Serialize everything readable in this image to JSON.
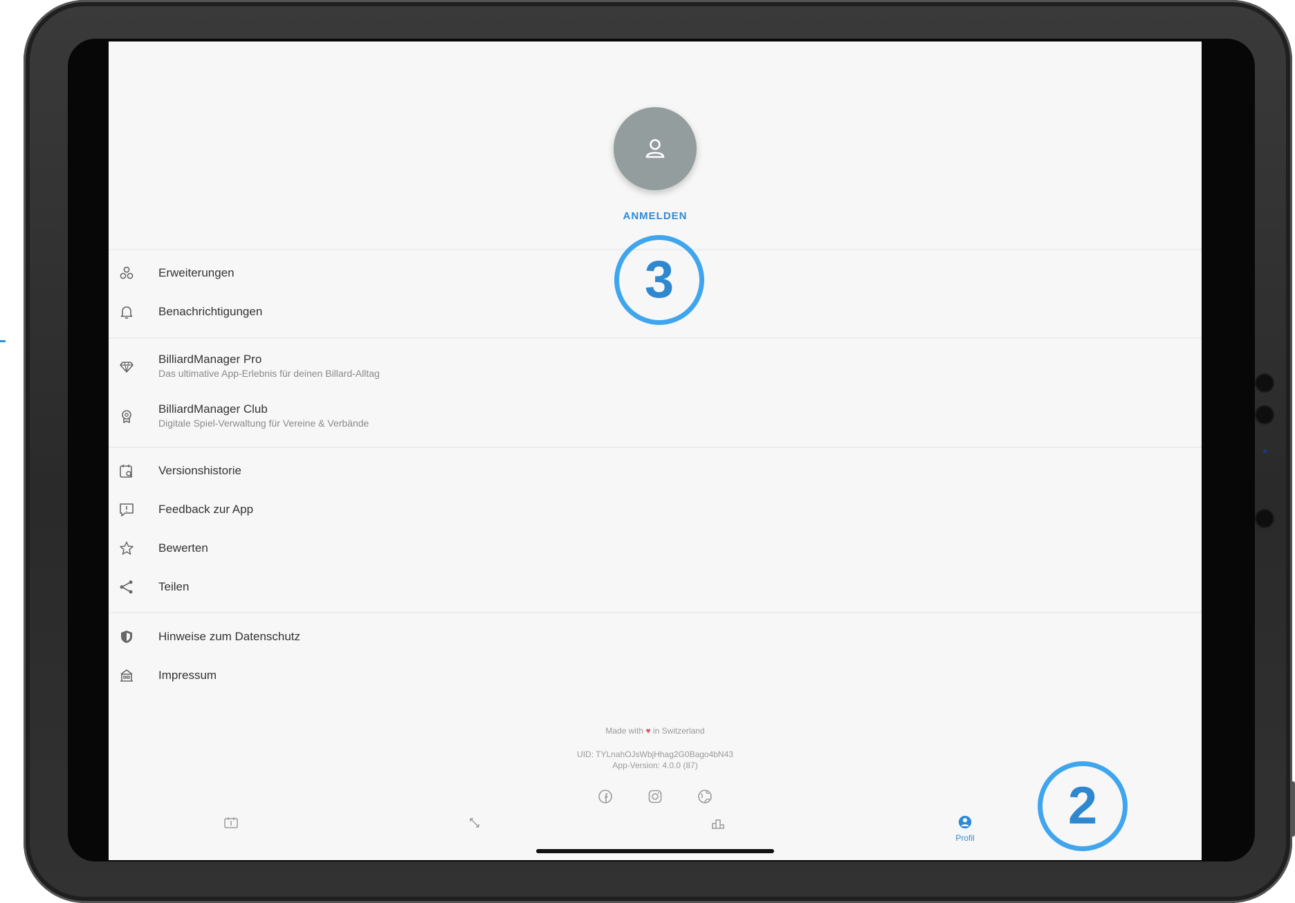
{
  "profile": {
    "login_label": "ANMELDEN"
  },
  "menu": {
    "group1": [
      {
        "label": "Erweiterungen",
        "icon": "extensions-icon"
      },
      {
        "label": "Benachrichtigungen",
        "icon": "bell-icon"
      }
    ],
    "group2": [
      {
        "label": "BilliardManager Pro",
        "sub": "Das ultimative App-Erlebnis für deinen Billard-Alltag",
        "icon": "diamond-icon"
      },
      {
        "label": "BilliardManager Club",
        "sub": "Digitale Spiel-Verwaltung für Vereine & Verbände",
        "icon": "award-icon"
      }
    ],
    "group3": [
      {
        "label": "Versionshistorie",
        "icon": "calendar-search-icon"
      },
      {
        "label": "Feedback zur App",
        "icon": "feedback-icon"
      },
      {
        "label": "Bewerten",
        "icon": "star-icon"
      },
      {
        "label": "Teilen",
        "icon": "share-icon"
      }
    ],
    "group4": [
      {
        "label": "Hinweise zum Datenschutz",
        "icon": "shield-icon"
      },
      {
        "label": "Impressum",
        "icon": "building-icon"
      }
    ]
  },
  "footer": {
    "made_with_prefix": "Made with",
    "made_with_suffix": "in Switzerland",
    "heart": "♥",
    "uid": "UID: TYLnahOJsWbjHhag2G0Bago4bN43",
    "app_version": "App-Version: 4.0.0 (87)",
    "social_icons": [
      "facebook-icon",
      "instagram-icon",
      "website-icon"
    ]
  },
  "tabbar": {
    "tabs": [
      {
        "icon": "scoreboard-icon",
        "label": ""
      },
      {
        "icon": "arrows-icon",
        "label": ""
      },
      {
        "icon": "ranking-icon",
        "label": ""
      },
      {
        "icon": "profile-icon",
        "label": "Profil",
        "active": true
      }
    ]
  },
  "callouts": {
    "step3": "3",
    "step2": "2"
  },
  "colors": {
    "accent": "#2e8ad8",
    "callout_ring": "#3fa5ef",
    "avatar_bg": "#939d9e",
    "screen_bg": "#f7f7f7",
    "heart": "#e0525a"
  }
}
